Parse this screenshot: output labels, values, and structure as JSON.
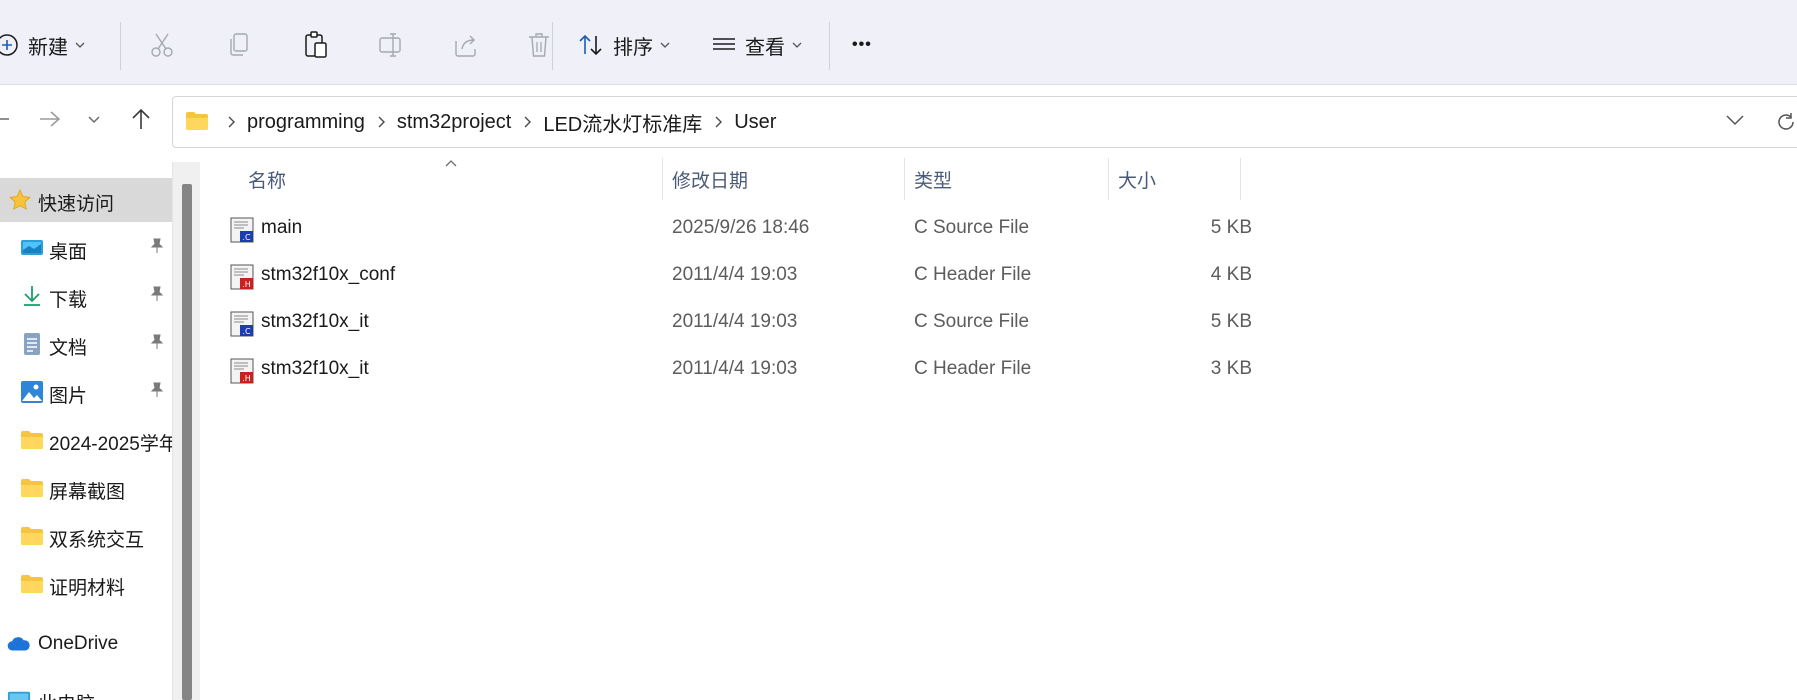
{
  "toolbar": {
    "new_label": "新建",
    "sort_label": "排序",
    "view_label": "查看",
    "more_label": "•••"
  },
  "navigation": {
    "breadcrumbs": [
      "programming",
      "stm32project",
      "LED流水灯标准库",
      "User"
    ]
  },
  "sidebar": {
    "items": [
      {
        "label": "快速访问",
        "icon": "star-icon",
        "pinned": false
      },
      {
        "label": "桌面",
        "icon": "desktop-icon",
        "pinned": true
      },
      {
        "label": "下载",
        "icon": "download-icon",
        "pinned": true
      },
      {
        "label": "文档",
        "icon": "document-icon",
        "pinned": true
      },
      {
        "label": "图片",
        "icon": "pictures-icon",
        "pinned": true
      },
      {
        "label": "2024-2025学年",
        "icon": "folder-icon",
        "pinned": false
      },
      {
        "label": "屏幕截图",
        "icon": "folder-icon",
        "pinned": false
      },
      {
        "label": "双系统交互",
        "icon": "folder-icon",
        "pinned": false
      },
      {
        "label": "证明材料",
        "icon": "folder-icon",
        "pinned": false
      },
      {
        "label": "OneDrive",
        "icon": "cloud-icon",
        "pinned": false
      },
      {
        "label": "此电脑",
        "icon": "computer-icon",
        "pinned": false
      }
    ]
  },
  "file_list": {
    "columns": [
      "名称",
      "修改日期",
      "类型",
      "大小"
    ],
    "rows": [
      {
        "name": "main",
        "date": "2025/9/26 18:46",
        "type": "C Source File",
        "size": "5 KB",
        "icon": "c-source-file-icon"
      },
      {
        "name": "stm32f10x_conf",
        "date": "2011/4/4 19:03",
        "type": "C Header File",
        "size": "4 KB",
        "icon": "c-header-file-icon"
      },
      {
        "name": "stm32f10x_it",
        "date": "2011/4/4 19:03",
        "type": "C Source File",
        "size": "5 KB",
        "icon": "c-source-file-icon"
      },
      {
        "name": "stm32f10x_it",
        "date": "2011/4/4 19:03",
        "type": "C Header File",
        "size": "3 KB",
        "icon": "c-header-file-icon"
      }
    ]
  },
  "colors": {
    "toolbar_bg": "#eff0f8",
    "selected_bg": "#d9d9d9",
    "folder_yellow": "#f5c542",
    "source_blue": "#1d3bb3",
    "header_red": "#cc1f1f"
  }
}
